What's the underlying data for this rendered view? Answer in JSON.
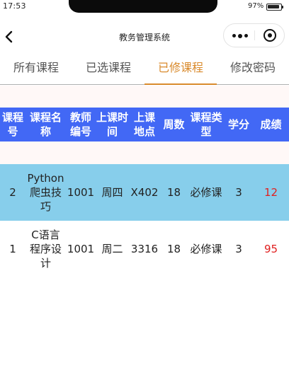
{
  "status_bar": {
    "time": "17:53",
    "battery_percent": "97%",
    "battery_level": 0.97
  },
  "nav": {
    "title": "教务管理系统",
    "back_icon": "chevron-left-icon",
    "more_icon": "more-dots-icon",
    "close_icon": "target-close-icon"
  },
  "tabs": [
    {
      "label": "所有课程"
    },
    {
      "label": "已选课程"
    },
    {
      "label": "已修课程",
      "active": true
    },
    {
      "label": "修改密码"
    }
  ],
  "colors": {
    "accent": "#d98a2c",
    "table_header": "#4268f5",
    "row_highlight": "#87ceeb",
    "grade": "#e02020",
    "content_bg": "#fff8f7"
  },
  "table": {
    "columns": [
      "课程号",
      "课程名称",
      "教师编号",
      "上课时间",
      "上课地点",
      "周数",
      "课程类型",
      "学分",
      "成绩"
    ],
    "rows": [
      [
        "2",
        "Python爬虫技巧",
        "1001",
        "周四",
        "X402",
        "18",
        "必修课",
        "3",
        "12"
      ],
      [
        "1",
        "C语言程序设计",
        "1001",
        "周二",
        "3316",
        "18",
        "必修课",
        "3",
        "95"
      ]
    ]
  }
}
